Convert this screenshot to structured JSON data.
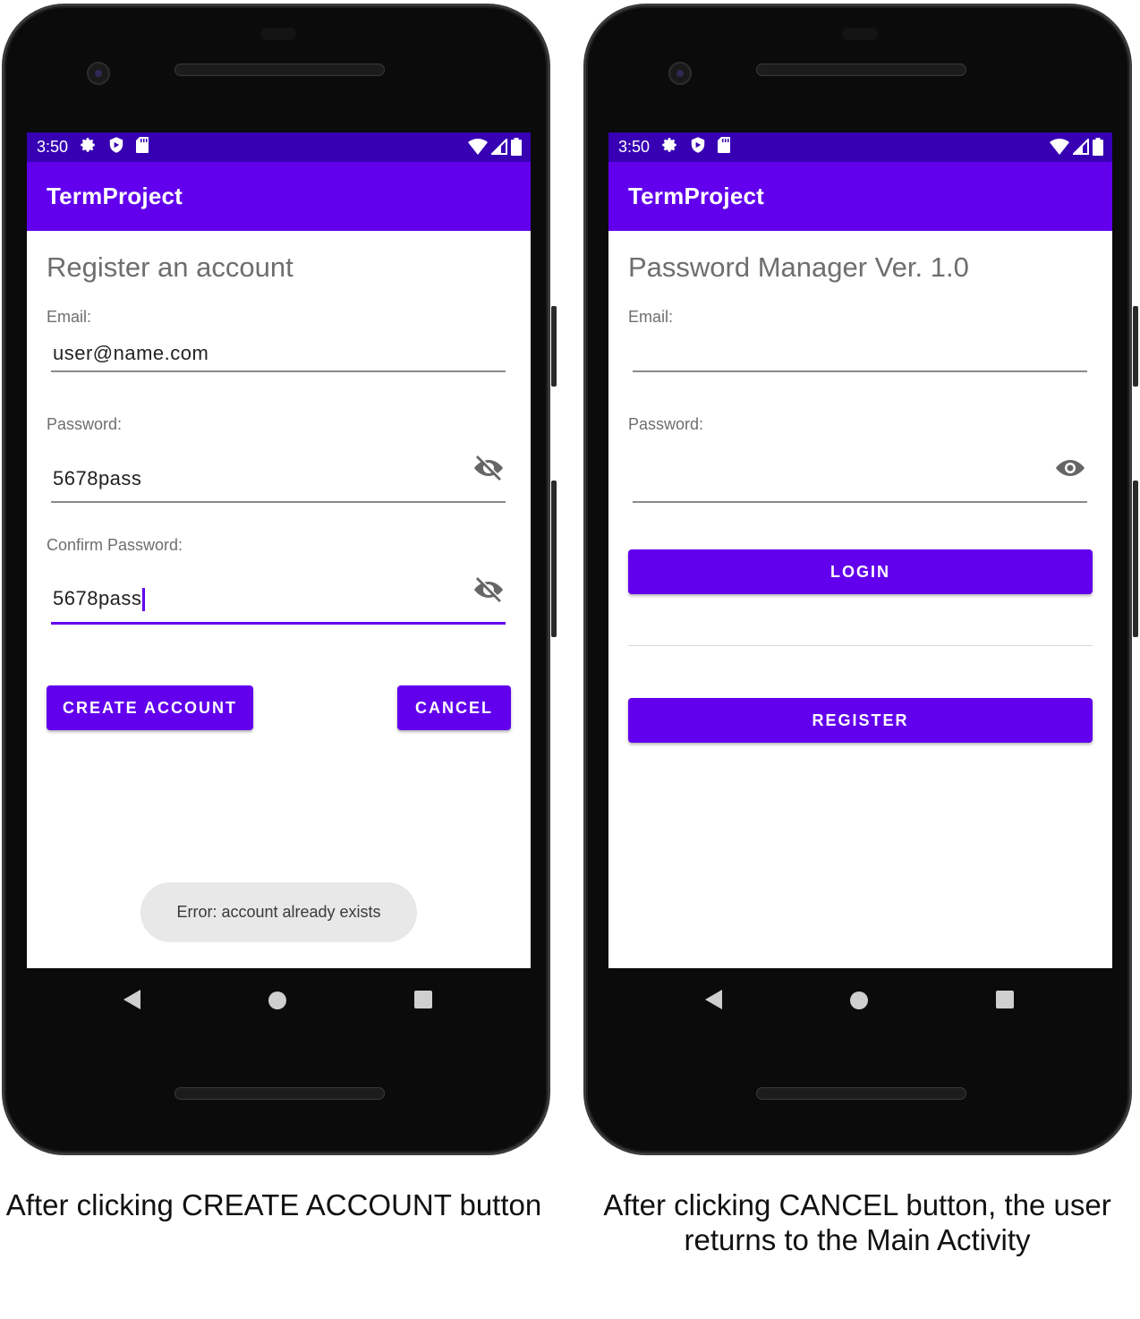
{
  "left": {
    "status_time": "3:50",
    "app_title": "TermProject",
    "heading": "Register an account",
    "email_label": "Email:",
    "email_value": "user@name.com",
    "password_label": "Password:",
    "password_value": "5678pass",
    "confirm_label": "Confirm Password:",
    "confirm_value": "5678pass",
    "create_button": "CREATE ACCOUNT",
    "cancel_button": "CANCEL",
    "toast": "Error: account already exists",
    "caption": "After clicking CREATE ACCOUNT button"
  },
  "right": {
    "status_time": "3:50",
    "app_title": "TermProject",
    "heading": "Password Manager Ver. 1.0",
    "email_label": "Email:",
    "email_value": "",
    "password_label": "Password:",
    "password_value": "",
    "login_button": "LOGIN",
    "register_button": "REGISTER",
    "caption_line1": "After clicking CANCEL button, the user",
    "caption_line2": "returns to the Main Activity"
  },
  "icons": {
    "status": [
      "gear-icon",
      "shield-icon",
      "sd-card-icon",
      "wifi-icon",
      "signal-icon",
      "battery-icon"
    ],
    "password_toggle_left": "eye-off-icon",
    "password_toggle_right": "eye-icon",
    "nav": [
      "back-icon",
      "home-icon",
      "recents-icon"
    ]
  },
  "colors": {
    "status_bar": "#3700b3",
    "app_bar": "#6200ee",
    "button": "#6200ee"
  }
}
